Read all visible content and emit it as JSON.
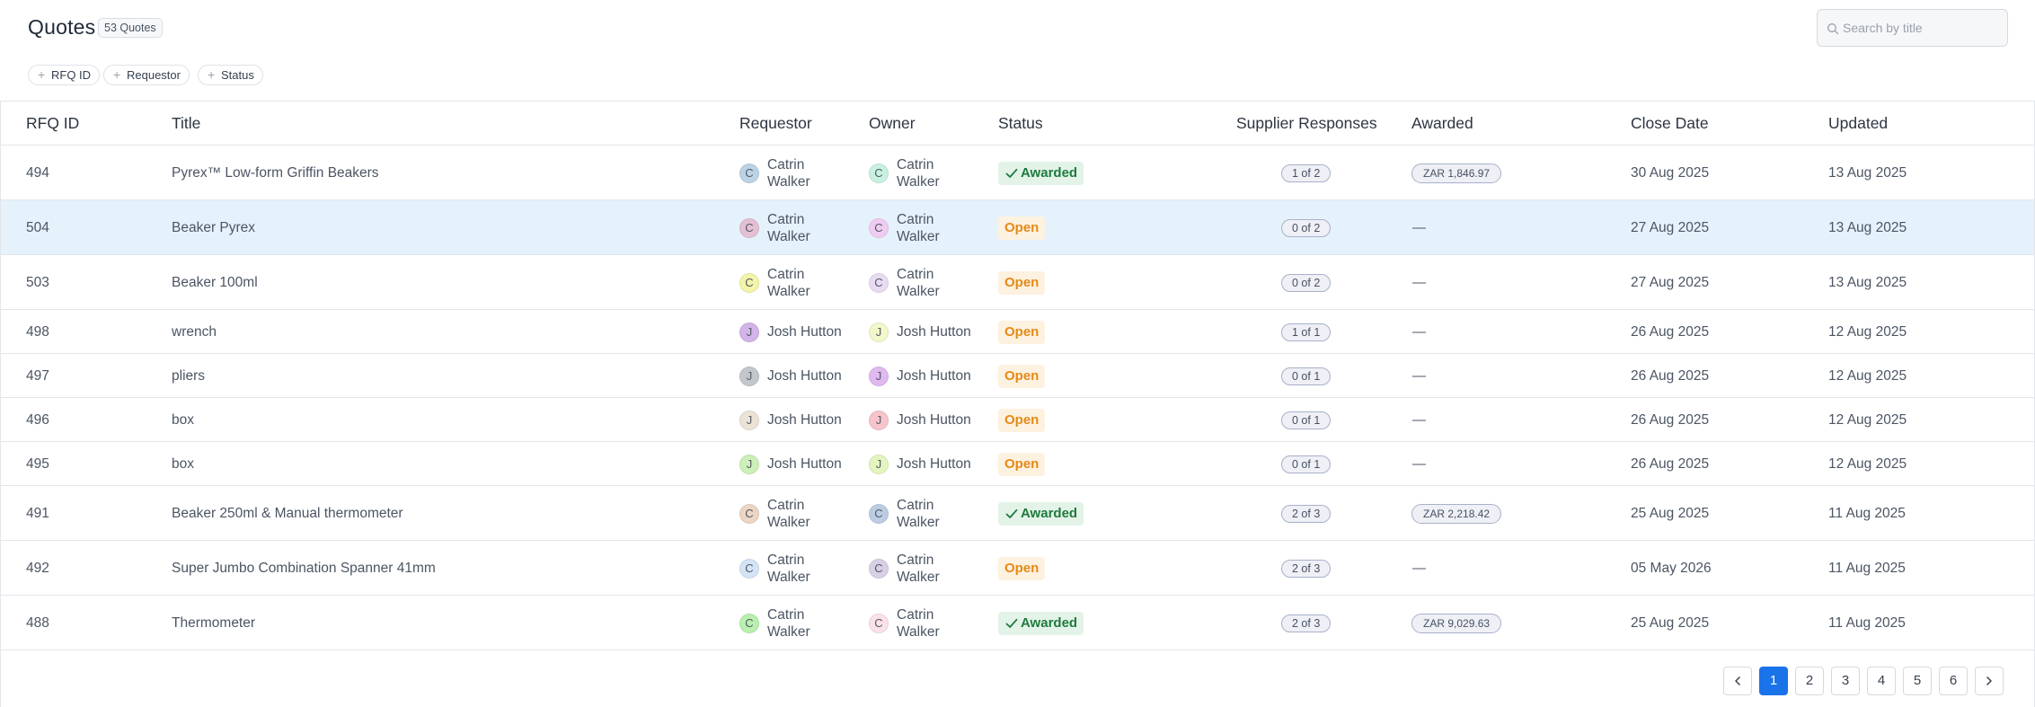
{
  "header": {
    "title": "Quotes",
    "count_badge": "53 Quotes",
    "search_placeholder": "Search by title"
  },
  "filters": [
    "RFQ ID",
    "Requestor",
    "Status"
  ],
  "columns": [
    "RFQ ID",
    "Title",
    "Requestor",
    "Owner",
    "Status",
    "Supplier Responses",
    "Awarded",
    "Close Date",
    "Updated"
  ],
  "rows": [
    {
      "id": "494",
      "title": "Pyrex™ Low-form Griffin Beakers",
      "req_initial": "C",
      "req_name": "Catrin Walker",
      "req_color": "#bcd3e6",
      "own_initial": "C",
      "own_name": "Catrin Walker",
      "own_color": "#c9f1e0",
      "status": "Awarded",
      "responses": "1 of 2",
      "awarded": "ZAR 1,846.97",
      "close": "30 Aug 2025",
      "updated": "13 Aug 2025"
    },
    {
      "id": "504",
      "title": "Beaker Pyrex",
      "req_initial": "C",
      "req_name": "Catrin Walker",
      "req_color": "#e5bfd4",
      "own_initial": "C",
      "own_name": "Catrin Walker",
      "own_color": "#f1ccf1",
      "status": "Open",
      "responses": "0 of 2",
      "awarded": "—",
      "close": "27 Aug 2025",
      "updated": "13 Aug 2025"
    },
    {
      "id": "503",
      "title": "Beaker 100ml",
      "req_initial": "C",
      "req_name": "Catrin Walker",
      "req_color": "#f3f5a8",
      "own_initial": "C",
      "own_name": "Catrin Walker",
      "own_color": "#e8dcf3",
      "status": "Open",
      "responses": "0 of 2",
      "awarded": "—",
      "close": "27 Aug 2025",
      "updated": "13 Aug 2025"
    },
    {
      "id": "498",
      "title": "wrench",
      "req_initial": "J",
      "req_name": "Josh Hutton",
      "req_color": "#d2b4e8",
      "own_initial": "J",
      "own_name": "Josh Hutton",
      "own_color": "#f3f7c9",
      "status": "Open",
      "responses": "1 of 1",
      "awarded": "—",
      "close": "26 Aug 2025",
      "updated": "12 Aug 2025"
    },
    {
      "id": "497",
      "title": "pliers",
      "req_initial": "J",
      "req_name": "Josh Hutton",
      "req_color": "#c3c7cc",
      "own_initial": "J",
      "own_name": "Josh Hutton",
      "own_color": "#e0b9f0",
      "status": "Open",
      "responses": "0 of 1",
      "awarded": "—",
      "close": "26 Aug 2025",
      "updated": "12 Aug 2025"
    },
    {
      "id": "496",
      "title": "box",
      "req_initial": "J",
      "req_name": "Josh Hutton",
      "req_color": "#ebe3d5",
      "own_initial": "J",
      "own_name": "Josh Hutton",
      "own_color": "#f7c4cc",
      "status": "Open",
      "responses": "0 of 1",
      "awarded": "—",
      "close": "26 Aug 2025",
      "updated": "12 Aug 2025"
    },
    {
      "id": "495",
      "title": "box",
      "req_initial": "J",
      "req_name": "Josh Hutton",
      "req_color": "#cdf0b8",
      "own_initial": "J",
      "own_name": "Josh Hutton",
      "own_color": "#e4f5c0",
      "status": "Open",
      "responses": "0 of 1",
      "awarded": "—",
      "close": "26 Aug 2025",
      "updated": "12 Aug 2025"
    },
    {
      "id": "491",
      "title": "Beaker 250ml & Manual thermometer",
      "req_initial": "C",
      "req_name": "Catrin Walker",
      "req_color": "#ecd6c3",
      "own_initial": "C",
      "own_name": "Catrin Walker",
      "own_color": "#bccde3",
      "status": "Awarded",
      "responses": "2 of 3",
      "awarded": "ZAR 2,218.42",
      "close": "25 Aug 2025",
      "updated": "11 Aug 2025"
    },
    {
      "id": "492",
      "title": "Super Jumbo Combination Spanner 41mm",
      "req_initial": "C",
      "req_name": "Catrin Walker",
      "req_color": "#d4e4f7",
      "own_initial": "C",
      "own_name": "Catrin Walker",
      "own_color": "#d8d0e4",
      "status": "Open",
      "responses": "2 of 3",
      "awarded": "—",
      "close": "05 May 2026",
      "updated": "11 Aug 2025"
    },
    {
      "id": "488",
      "title": "Thermometer",
      "req_initial": "C",
      "req_name": "Catrin Walker",
      "req_color": "#b9f0b0",
      "own_initial": "C",
      "own_name": "Catrin Walker",
      "own_color": "#fbe1ea",
      "status": "Awarded",
      "responses": "2 of 3",
      "awarded": "ZAR 9,029.63",
      "close": "25 Aug 2025",
      "updated": "11 Aug 2025"
    }
  ],
  "selected_row": "504",
  "pagination": {
    "pages": [
      "1",
      "2",
      "3",
      "4",
      "5",
      "6"
    ],
    "current": "1"
  },
  "colors": {
    "accent": "#1a73e8",
    "awarded_bg": "#e3f3e8",
    "awarded_text": "#1f7a3e",
    "open_bg": "#fdf1e0",
    "open_text": "#e58a17",
    "selected_row_bg": "#e5f2fb"
  }
}
